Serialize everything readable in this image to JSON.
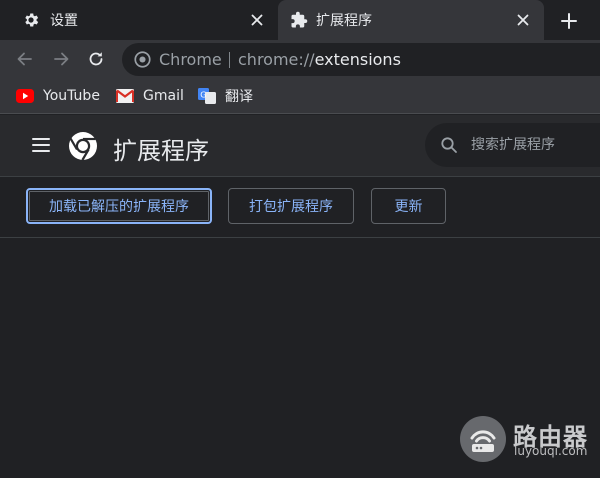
{
  "tabs": [
    {
      "title": "设置",
      "icon": "gear-icon"
    },
    {
      "title": "扩展程序",
      "icon": "puzzle-icon",
      "active": true
    }
  ],
  "toolbar": {
    "omnibox": {
      "site_label": "Chrome",
      "url_scheme": "chrome://",
      "url_host": "extensions"
    }
  },
  "bookmarks": [
    {
      "label": "YouTube",
      "icon": "youtube-icon"
    },
    {
      "label": "Gmail",
      "icon": "gmail-icon"
    },
    {
      "label": "翻译",
      "icon": "google-translate-icon"
    }
  ],
  "header": {
    "title": "扩展程序",
    "search_placeholder": "搜索扩展程序"
  },
  "actions": {
    "load_unpacked": "加载已解压的扩展程序",
    "pack": "打包扩展程序",
    "update": "更新"
  },
  "watermark": {
    "title": "路由器",
    "subtitle": "luyouqi.com"
  },
  "colors": {
    "background": "#202124",
    "toolbar": "#35363a",
    "accent": "#8ab4f8",
    "text": "#e8eaed"
  }
}
